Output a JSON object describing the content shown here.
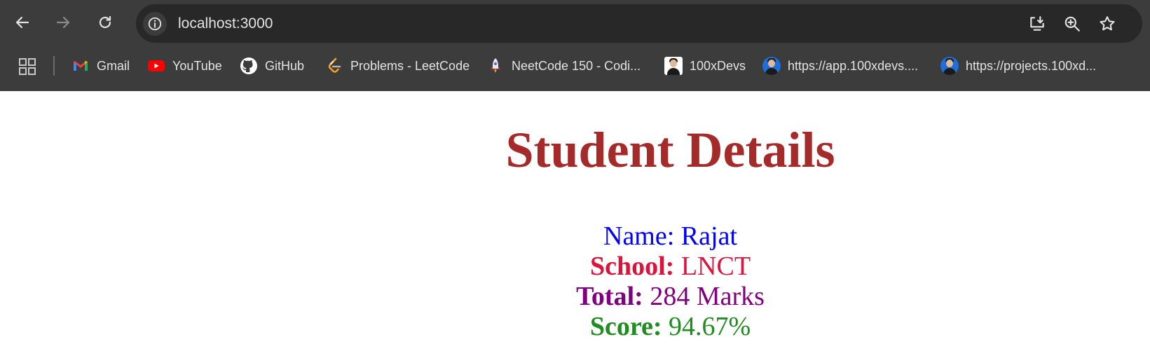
{
  "browser": {
    "url": "localhost:3000",
    "bookmarks": [
      {
        "label": "Gmail",
        "icon": "gmail-icon"
      },
      {
        "label": "YouTube",
        "icon": "youtube-icon"
      },
      {
        "label": "GitHub",
        "icon": "github-icon"
      },
      {
        "label": "Problems - LeetCode",
        "icon": "leetcode-icon"
      },
      {
        "label": "NeetCode 150 - Codi...",
        "icon": "rocket-icon"
      },
      {
        "label": "100xDevs",
        "icon": "avatar-icon"
      },
      {
        "label": "https://app.100xdevs....",
        "icon": "avatar-icon"
      },
      {
        "label": "https://projects.100xd...",
        "icon": "avatar-icon"
      }
    ],
    "colors": {
      "toolbar_bg": "#3c3c3c",
      "omnibox_bg": "#282828",
      "toolbar_text": "#e3e3e3"
    }
  },
  "page": {
    "title": "Student Details",
    "name_label": "Name:",
    "name_value": "Rajat",
    "school_label": "School:",
    "school_value": "LNCT",
    "total_label": "Total:",
    "total_value": "284 Marks",
    "score_label": "Score:",
    "score_value": "94.67%",
    "colors": {
      "title": "#a52a2a",
      "name": "#0000ff",
      "school": "#dc143c",
      "total": "#800080",
      "score": "#228b22"
    }
  }
}
